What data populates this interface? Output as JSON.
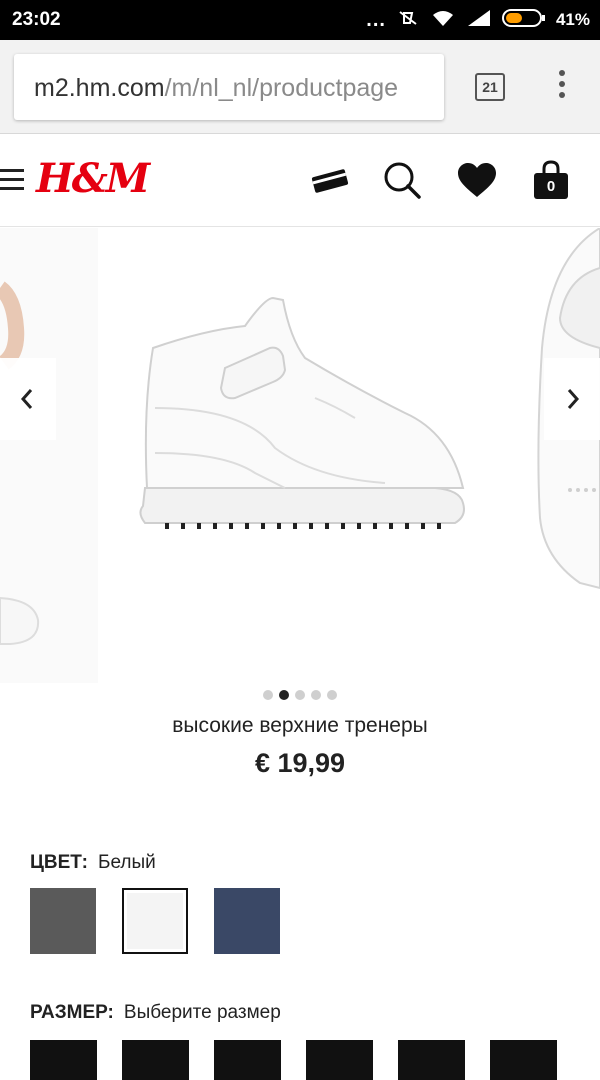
{
  "status_bar": {
    "time": "23:02",
    "battery": "41%",
    "dots": "..."
  },
  "browser": {
    "url_host": "m2.hm.com",
    "url_path": "/m/nl_nl/productpage",
    "tab_count": "21"
  },
  "header": {
    "logo": "H&M",
    "cart_count": "0"
  },
  "product": {
    "name": "высокие верхние тренеры",
    "price": "€ 19,99",
    "image_count": 5,
    "active_image": 2
  },
  "color": {
    "label": "ЦВЕТ:",
    "value": "Белый",
    "swatches": [
      "#5a5a5a",
      "#f4f4f4",
      "#3a4866"
    ]
  },
  "size": {
    "label": "РАЗМЕР:",
    "value": "Выберите размер"
  },
  "colors": {
    "brand": "#e50010",
    "text": "#222222"
  }
}
